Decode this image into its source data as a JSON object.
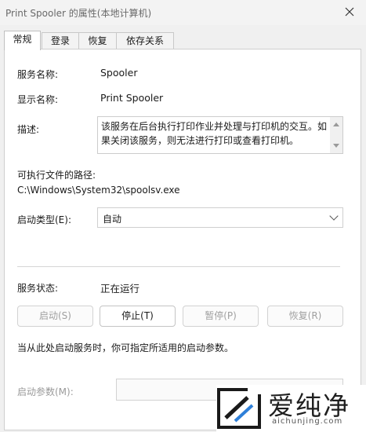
{
  "window": {
    "title": "Print Spooler 的属性(本地计算机)"
  },
  "tabs": [
    {
      "label": "常规"
    },
    {
      "label": "登录"
    },
    {
      "label": "恢复"
    },
    {
      "label": "依存关系"
    }
  ],
  "general": {
    "service_name_label": "服务名称:",
    "service_name_value": "Spooler",
    "display_name_label": "显示名称:",
    "display_name_value": "Print Spooler",
    "description_label": "描述:",
    "description_value": "该服务在后台执行打印作业并处理与打印机的交互。如果关闭该服务，则无法进行打印或查看打印机。",
    "exe_path_label": "可执行文件的路径:",
    "exe_path_value": "C:\\Windows\\System32\\spoolsv.exe",
    "startup_type_label": "启动类型(E):",
    "startup_type_value": "自动",
    "status_label": "服务状态:",
    "status_value": "正在运行",
    "buttons": {
      "start": "启动(S)",
      "stop": "停止(T)",
      "pause": "暂停(P)",
      "resume": "恢复(R)"
    },
    "params_hint": "当从此处启动服务时，你可指定所适用的启动参数。",
    "start_params_label": "启动参数(M):",
    "start_params_value": ""
  },
  "watermark": {
    "text": "爱纯净",
    "url": "aichunjing.com"
  }
}
